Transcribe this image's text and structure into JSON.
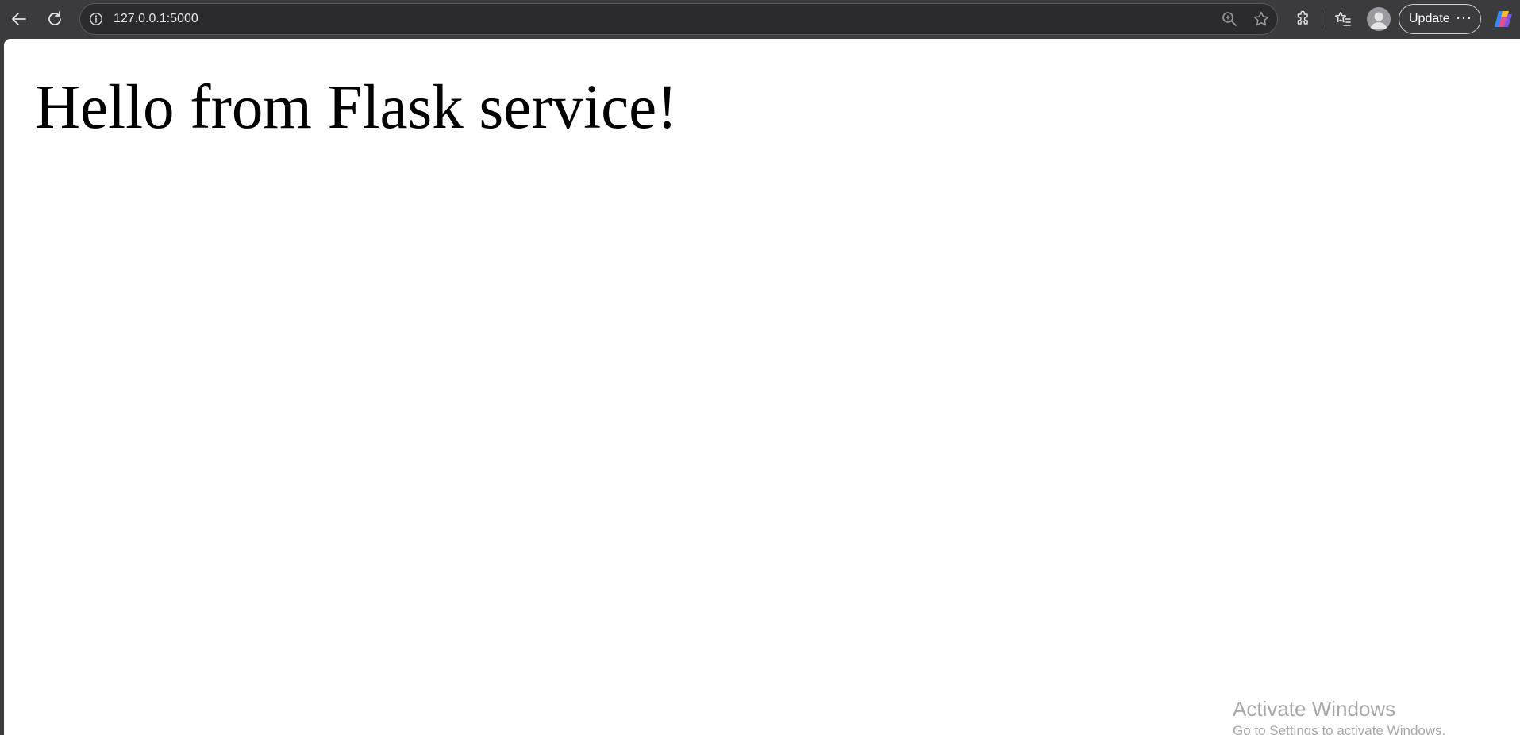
{
  "browser": {
    "url": "127.0.0.1:5000",
    "update_label": "Update",
    "more_label": "···",
    "icons": {
      "back": "back-arrow-icon",
      "reload": "reload-icon",
      "site_info": "info-icon",
      "zoom": "zoom-in-icon",
      "favorite": "star-icon",
      "extensions": "puzzle-icon",
      "favorites_list": "favorites-icon",
      "profile": "profile-icon",
      "copilot": "copilot-icon"
    },
    "colors": {
      "toolbar": "#3b3b3e",
      "address_bar": "#2b2b2e",
      "page_background": "#ffffff"
    }
  },
  "page": {
    "heading": "Hello from Flask service!"
  },
  "watermark": {
    "title": "Activate Windows",
    "subtitle": "Go to Settings to activate Windows."
  }
}
